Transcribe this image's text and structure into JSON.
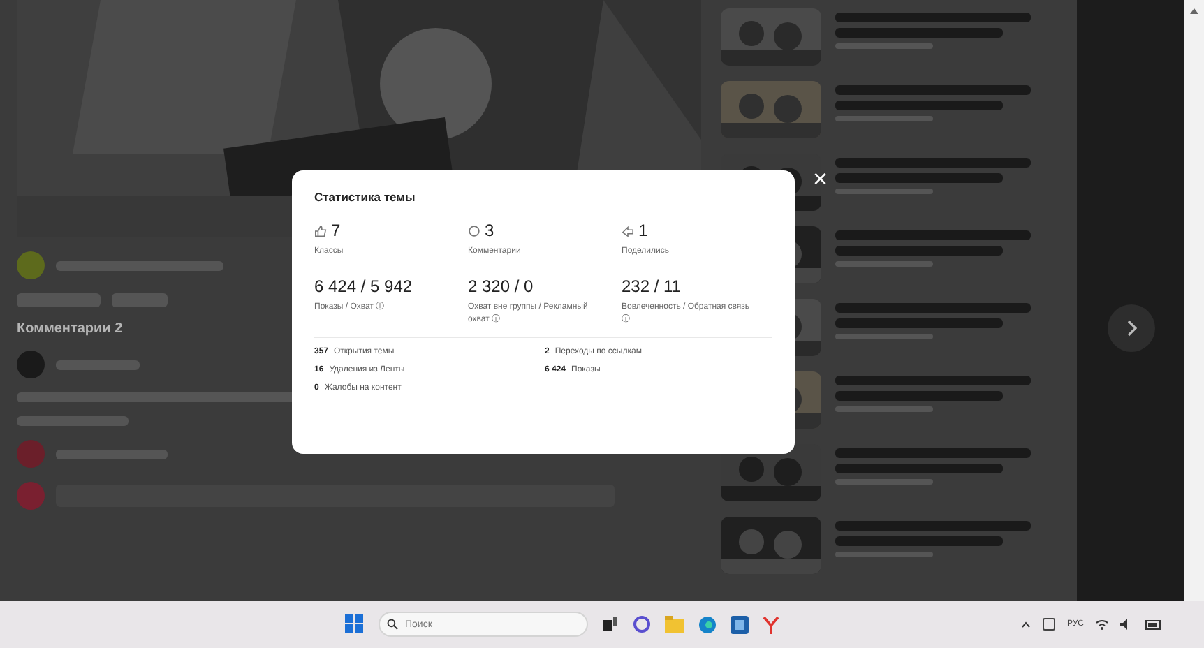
{
  "modal": {
    "title": "Статистика темы",
    "top_stats": [
      {
        "kind": "likes",
        "value": "7",
        "label": "Классы"
      },
      {
        "kind": "comments",
        "value": "3",
        "label": "Комментарии"
      },
      {
        "kind": "shares",
        "value": "1",
        "label": "Поделились"
      }
    ],
    "mid_stats": [
      {
        "value": "6 424 / 5 942",
        "label": "Показы / Охват ⓘ"
      },
      {
        "value": "2 320 / 0",
        "label": "Охват вне группы / Рекламный охват ⓘ"
      },
      {
        "value": "232 / 11",
        "label": "Вовлеченность / Обратная связь ⓘ"
      }
    ],
    "details": [
      {
        "value": "357",
        "label": "Открытия темы"
      },
      {
        "value": "2",
        "label": "Переходы по ссылкам"
      },
      {
        "value": "16",
        "label": "Удаления из Ленты"
      },
      {
        "value": "6 424",
        "label": "Показы"
      },
      {
        "value": "0",
        "label": "Жалобы на контент"
      }
    ],
    "close": "×"
  },
  "post": {
    "comments_heading": "Комментарии 2"
  },
  "taskbar": {
    "search_placeholder": "Поиск",
    "language": "РУС"
  }
}
